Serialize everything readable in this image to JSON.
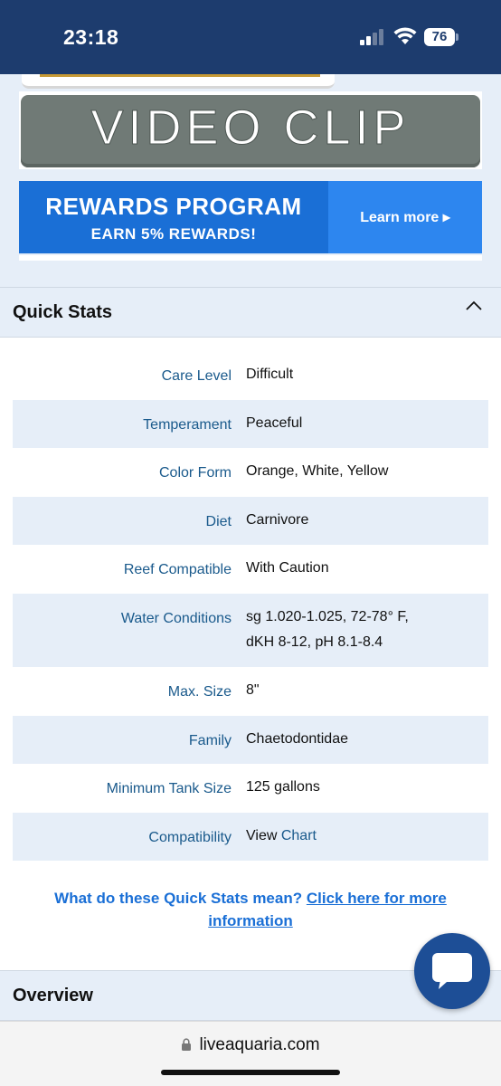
{
  "status_bar": {
    "time": "23:18",
    "battery": "76"
  },
  "promos": {
    "video_clip_label": "VIDEO CLIP",
    "rewards_title": "REWARDS PROGRAM",
    "rewards_subtitle": "EARN 5% REWARDS!",
    "rewards_cta": "Learn more ▸"
  },
  "quick_stats": {
    "title": "Quick Stats",
    "rows": [
      {
        "label": "Care Level",
        "value": "Difficult"
      },
      {
        "label": "Temperament",
        "value": "Peaceful"
      },
      {
        "label": "Color Form",
        "value": "Orange, White, Yellow"
      },
      {
        "label": "Diet",
        "value": "Carnivore"
      },
      {
        "label": "Reef Compatible",
        "value": "With Caution"
      },
      {
        "label": "Water Conditions",
        "value": "sg 1.020-1.025, 72-78° F,",
        "value2": "dKH 8-12, pH 8.1-8.4"
      },
      {
        "label": "Max. Size",
        "value": "8\""
      },
      {
        "label": "Family",
        "value": "Chaetodontidae"
      },
      {
        "label": "Minimum Tank Size",
        "value": "125 gallons"
      },
      {
        "label": "Compatibility",
        "value": "View",
        "link": "Chart"
      }
    ],
    "help_prefix": "What do these Quick Stats mean?",
    "help_link": "Click here for more information"
  },
  "overview": {
    "title": "Overview"
  },
  "browser": {
    "url": "liveaquaria.com"
  },
  "colors": {
    "header_navy": "#1d3c6e",
    "link_blue": "#1a5a8c",
    "accent_blue": "#1a6fd6",
    "row_shade": "#e6eef8"
  }
}
